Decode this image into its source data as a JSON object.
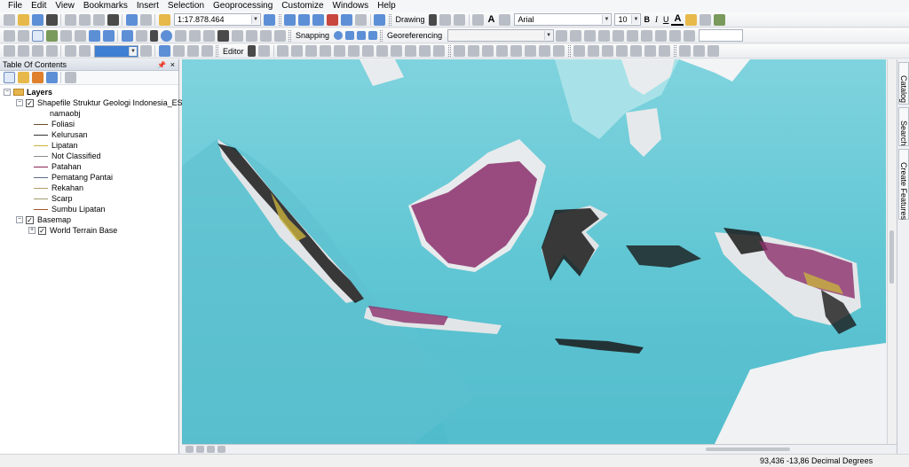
{
  "menu": [
    "File",
    "Edit",
    "View",
    "Bookmarks",
    "Insert",
    "Selection",
    "Geoprocessing",
    "Customize",
    "Windows",
    "Help"
  ],
  "toolbar": {
    "scale": "1:17.878.464",
    "drawing": "Drawing",
    "font_name": "Arial",
    "font_size": "10",
    "bold": "B",
    "italic": "I",
    "underline": "U",
    "font_color": "A",
    "snapping": "Snapping",
    "georeferencing": "Georeferencing",
    "editor": "Editor"
  },
  "toc": {
    "title": "Table Of Contents",
    "pin": "p",
    "close": "×",
    "layers_label": "Layers",
    "shapefile": "Shapefile Struktur Geologi Indonesia_ESDM",
    "field": "namaobj",
    "classes": [
      {
        "label": "Foliasi",
        "color": "#6b4a2d"
      },
      {
        "label": "Kelurusan",
        "color": "#333333"
      },
      {
        "label": "Lipatan",
        "color": "#c9b33a"
      },
      {
        "label": "Not Classified",
        "color": "#8a8a8a"
      },
      {
        "label": "Patahan",
        "color": "#8b2252"
      },
      {
        "label": "Pematang Pantai",
        "color": "#5a6b8c"
      },
      {
        "label": "Rekahan",
        "color": "#b59a6a"
      },
      {
        "label": "Scarp",
        "color": "#9b9b6b"
      },
      {
        "label": "Sumbu Lipatan",
        "color": "#a0522d"
      }
    ],
    "basemap": "Basemap",
    "world_terrain": "World Terrain Base"
  },
  "right_tabs": [
    "Catalog",
    "Search",
    "Create Features"
  ],
  "status": {
    "coords": "93,436  -13,86 Decimal Degrees"
  }
}
